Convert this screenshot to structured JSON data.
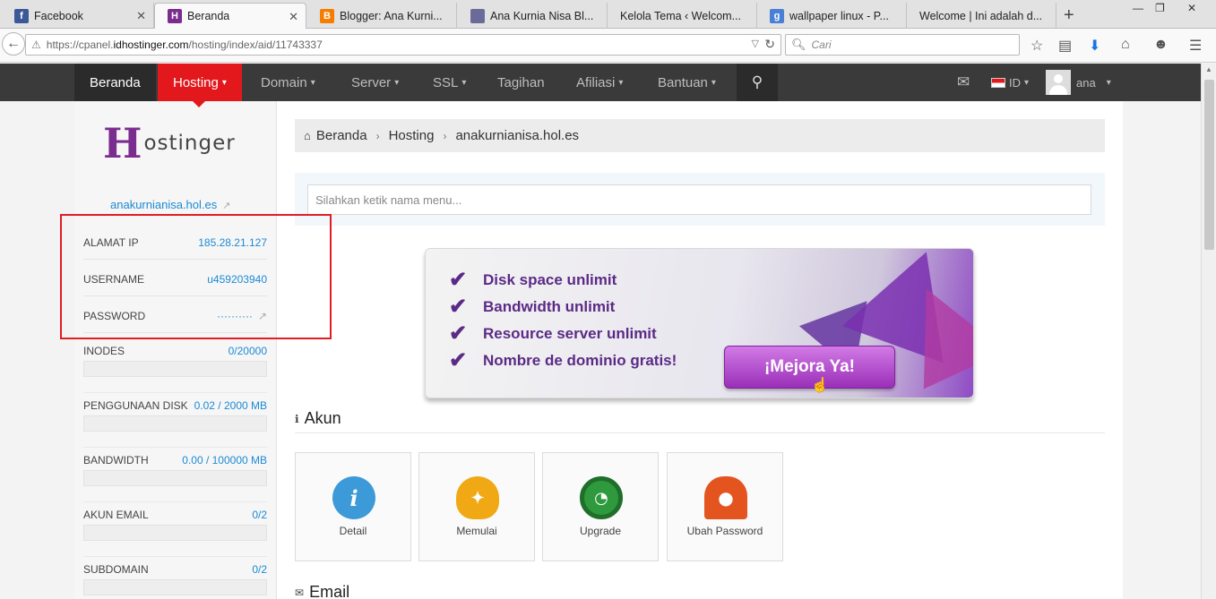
{
  "browser": {
    "tabs": [
      {
        "label": "Facebook",
        "favicon": "facebook-icon",
        "color": "#3b5998",
        "glyph": "f",
        "active": false
      },
      {
        "label": "Beranda",
        "favicon": "hostinger-icon",
        "color": "#7b2d8f",
        "glyph": "H",
        "active": true
      },
      {
        "label": "Blogger: Ana Kurni...",
        "favicon": "blogger-icon",
        "color": "#f57d00",
        "glyph": "B",
        "active": false
      },
      {
        "label": "Ana Kurnia Nisa Bl...",
        "favicon": "anime-avatar-icon",
        "color": "#6b6b9b",
        "glyph": "",
        "active": false
      },
      {
        "label": "Kelola Tema ‹ Welcom...",
        "favicon": "",
        "color": "",
        "glyph": "",
        "active": false
      },
      {
        "label": "wallpaper linux - P...",
        "favicon": "google-icon",
        "color": "#4a7fd8",
        "glyph": "g",
        "active": false
      },
      {
        "label": "Welcome | Ini adalah d...",
        "favicon": "",
        "color": "",
        "glyph": "",
        "active": false
      }
    ],
    "url_prefix": "https://cpanel.",
    "url_host": "idhostinger.com",
    "url_path": "/hosting/index/aid/11743337",
    "search_placeholder": "Cari"
  },
  "topnav": {
    "home": "Beranda",
    "items": [
      "Hosting",
      "Domain",
      "Server",
      "SSL",
      "Tagihan",
      "Afiliasi",
      "Bantuan"
    ],
    "language": "ID",
    "user": "ana"
  },
  "sidebar": {
    "logo_text": "ostinger",
    "logo_initial": "H",
    "domain": "anakurnianisa.hol.es",
    "info": [
      {
        "key": "ALAMAT IP",
        "value": "185.28.21.127"
      },
      {
        "key": "USERNAME",
        "value": "u459203940"
      },
      {
        "key": "PASSWORD",
        "value": "··········"
      }
    ],
    "usage": [
      {
        "key": "INODES",
        "value": "0/20000",
        "fraction": 0
      },
      {
        "key": "PENGGUNAAN DISK",
        "value": "0.02 / 2000 MB",
        "fraction": 0
      },
      {
        "key": "BANDWIDTH",
        "value": "0.00 / 100000 MB",
        "fraction": 0
      },
      {
        "key": "AKUN EMAIL",
        "value": "0/2",
        "fraction": 0
      },
      {
        "key": "SUBDOMAIN",
        "value": "0/2",
        "fraction": 0
      }
    ]
  },
  "main": {
    "breadcrumb": [
      "Beranda",
      "Hosting",
      "anakurnianisa.hol.es"
    ],
    "menu_search_placeholder": "Silahkan ketik nama menu...",
    "banner": {
      "lines": [
        "Disk space unlimit",
        "Bandwidth unlimit",
        "Resource server unlimit",
        "Nombre de dominio gratis!"
      ],
      "cta": "¡Mejora Ya!"
    },
    "section_akun": "Akun",
    "tiles": [
      {
        "label": "Detail",
        "icon": "info-icon",
        "color": "#3d9ad8"
      },
      {
        "label": "Memulai",
        "icon": "lightbulb-icon",
        "color": "#f0a915"
      },
      {
        "label": "Upgrade",
        "icon": "speedometer-icon",
        "color": "#2e9a3d"
      },
      {
        "label": "Ubah Password",
        "icon": "lock-icon",
        "color": "#e3541e"
      }
    ],
    "section_email": "Email"
  },
  "colors": {
    "accent": "#e3181d",
    "link": "#1c8ad4",
    "brand": "#7b2d8f",
    "highlight_box": "#e31b23"
  }
}
